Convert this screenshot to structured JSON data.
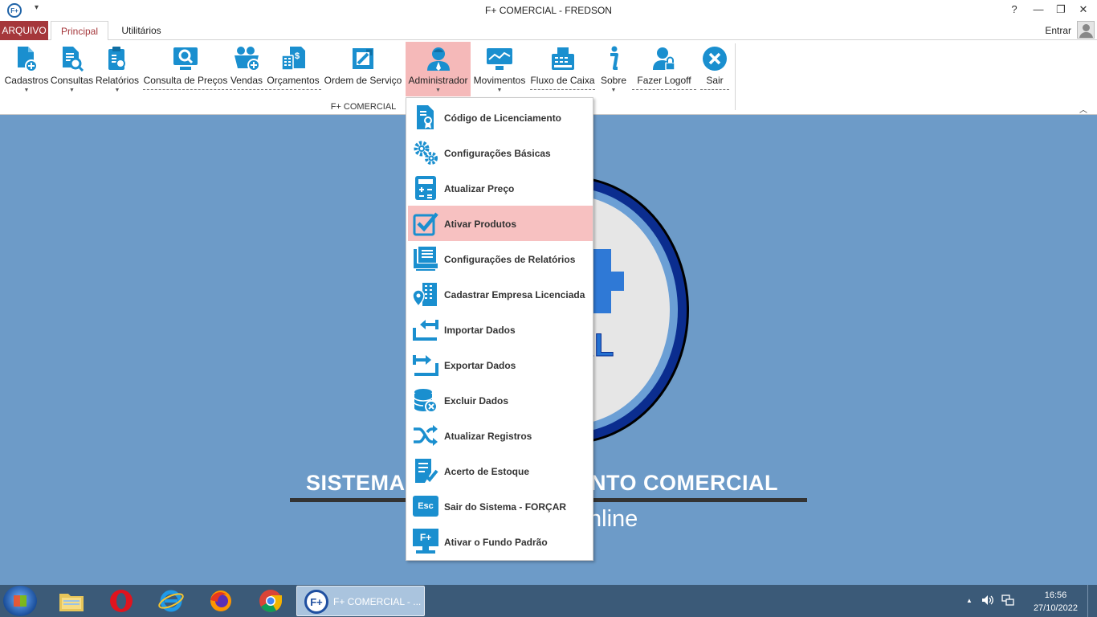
{
  "window": {
    "app_icon": "F+",
    "quick_access": "▾",
    "title": "F+ COMERCIAL - FREDSON",
    "help": "?",
    "minimize": "—",
    "restore": "❐",
    "close": "✕"
  },
  "tabs": {
    "arquivo": "ARQUIVO",
    "principal": "Principal",
    "utilitarios": "Utilitários"
  },
  "user": {
    "login_label": "Entrar"
  },
  "ribbon": {
    "group_label": "F+ COMERCIAL",
    "collapse": "︿",
    "dropdown_arrow": "▼",
    "buttons": [
      {
        "label": "Cadastros"
      },
      {
        "label": "Consultas"
      },
      {
        "label": "Relatórios"
      },
      {
        "label": "Consulta de Preços"
      },
      {
        "label": "Vendas"
      },
      {
        "label": "Orçamentos"
      },
      {
        "label": "Ordem de Serviço"
      },
      {
        "label": "Administrador"
      },
      {
        "label": "Movimentos"
      },
      {
        "label": "Fluxo de Caixa"
      },
      {
        "label": "Sobre"
      },
      {
        "label": "Fazer Logoff"
      },
      {
        "label": "Sair"
      }
    ]
  },
  "background": {
    "logo_text": "IAL",
    "banner_left": "SISTEMA",
    "banner_right": "ENTO COMERCIAL",
    "online": "nline"
  },
  "admin_menu": {
    "items": [
      {
        "label": "Código de Licenciamento",
        "icon": "license-document-icon"
      },
      {
        "label": "Configurações Básicas",
        "icon": "gears-icon"
      },
      {
        "label": "Atualizar Preço",
        "icon": "calculator-icon"
      },
      {
        "label": "Ativar Produtos",
        "icon": "checkbox-checked-icon"
      },
      {
        "label": "Configurações de Relatórios",
        "icon": "printer-report-icon"
      },
      {
        "label": "Cadastrar Empresa Licenciada",
        "icon": "building-location-icon"
      },
      {
        "label": "Importar Dados",
        "icon": "import-icon"
      },
      {
        "label": "Exportar Dados",
        "icon": "export-icon"
      },
      {
        "label": "Excluir Dados",
        "icon": "database-delete-icon"
      },
      {
        "label": "Atualizar Registros",
        "icon": "shuffle-icon"
      },
      {
        "label": "Acerto de Estoque",
        "icon": "checklist-icon"
      },
      {
        "label": "Sair do Sistema - FORÇAR",
        "icon": "esc-key-icon",
        "badge": "Esc"
      },
      {
        "label": "Ativar o Fundo Padrão",
        "icon": "monitor-fplus-icon",
        "badge": "F+"
      }
    ]
  },
  "taskbar": {
    "active_window": "F+ COMERCIAL - ...",
    "active_icon": "F+",
    "tray_arrow": "▲",
    "time": "16:56",
    "date": "27/10/2022"
  },
  "colors": {
    "accent": "#a5373b",
    "icon_blue": "#1a8fcf",
    "highlight": "#f7c1c1",
    "desktop": "#6d9bc8"
  }
}
